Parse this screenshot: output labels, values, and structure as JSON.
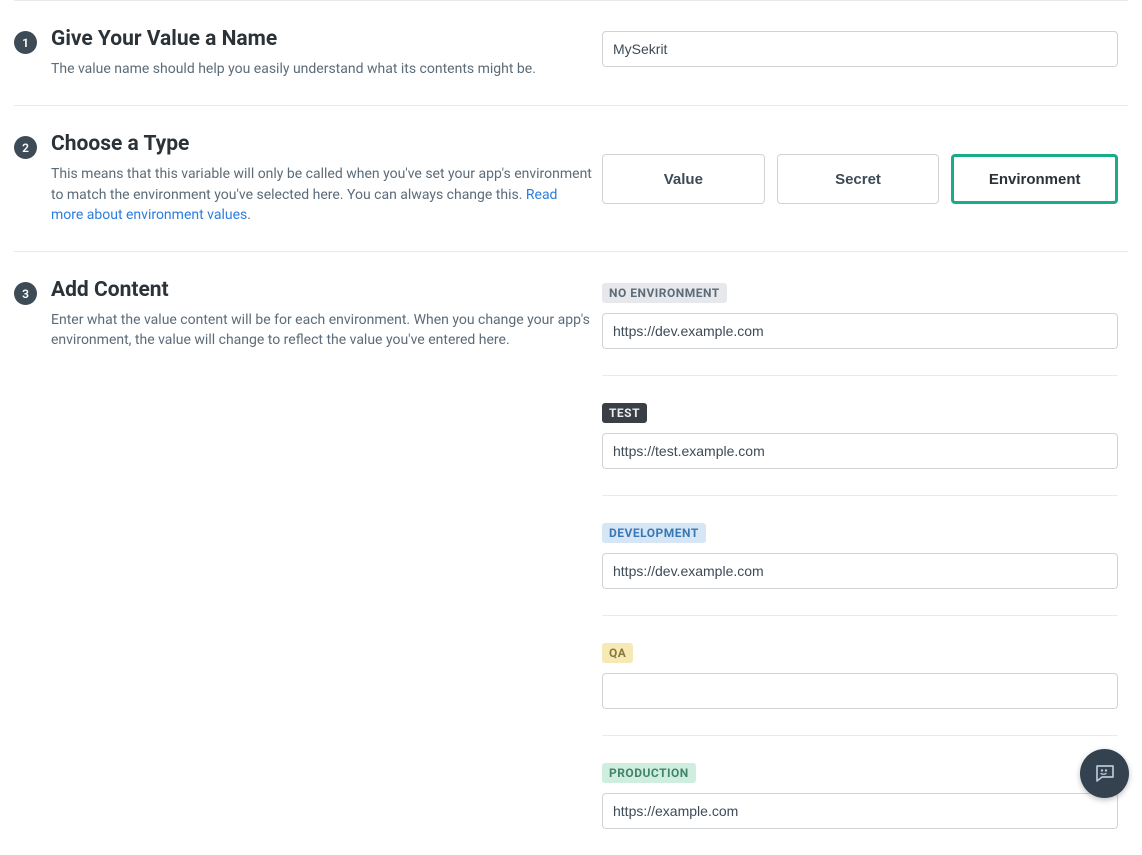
{
  "step1": {
    "num": "1",
    "title": "Give Your Value a Name",
    "desc": "The value name should help you easily understand what its contents might be.",
    "value": "MySekrit"
  },
  "step2": {
    "num": "2",
    "title": "Choose a Type",
    "desc": "This means that this variable will only be called when you've set your app's environment to match the environment you've selected here. You can always change this. ",
    "link": "Read more about environment values",
    "period": ".",
    "options": {
      "value": "Value",
      "secret": "Secret",
      "environment": "Environment"
    },
    "selected": "environment"
  },
  "step3": {
    "num": "3",
    "title": "Add Content",
    "desc": "Enter what the value content will be for each environment. When you change your app's environment, the value will change to reflect the value you've entered here.",
    "envs": [
      {
        "label": "NO ENVIRONMENT",
        "cls": "gray",
        "value": "https://dev.example.com"
      },
      {
        "label": "TEST",
        "cls": "dark",
        "value": "https://test.example.com"
      },
      {
        "label": "DEVELOPMENT",
        "cls": "blue",
        "value": "https://dev.example.com"
      },
      {
        "label": "QA",
        "cls": "yellow",
        "value": ""
      },
      {
        "label": "PRODUCTION",
        "cls": "green",
        "value": "https://example.com"
      }
    ]
  }
}
